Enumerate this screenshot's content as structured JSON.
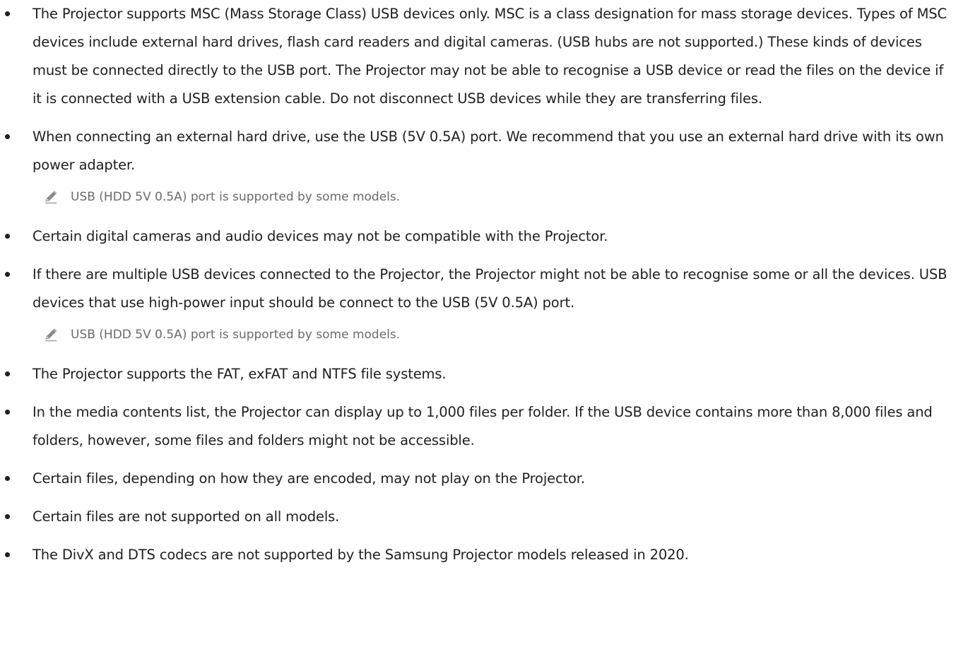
{
  "items": [
    {
      "text": "The Projector supports MSC (Mass Storage Class) USB devices only. MSC is a class designation for mass storage devices. Types of MSC devices include external hard drives, flash card readers and digital cameras. (USB hubs are not supported.) These kinds of devices must be connected directly to the USB port. The Projector may not be able to recognise a USB device or read the files on the device if it is connected with a USB extension cable. Do not disconnect USB devices while they are transferring files."
    },
    {
      "text": "When connecting an external hard drive, use the USB (5V 0.5A) port. We recommend that you use an external hard drive with its own power adapter.",
      "note": "USB (HDD 5V 0.5A) port is supported by some models."
    },
    {
      "text": "Certain digital cameras and audio devices may not be compatible with the Projector."
    },
    {
      "text": "If there are multiple USB devices connected to the Projector, the Projector might not be able to recognise some or all the devices. USB devices that use high-power input should be connect to the USB (5V 0.5A) port.",
      "note": "USB (HDD 5V 0.5A) port is supported by some models."
    },
    {
      "text": "The Projector supports the FAT, exFAT and NTFS file systems."
    },
    {
      "text": "In the media contents list, the Projector can display up to 1,000 files per folder. If the USB device contains more than 8,000 files and folders, however, some files and folders might not be accessible."
    },
    {
      "text": "Certain files, depending on how they are encoded, may not play on the Projector."
    },
    {
      "text": "Certain files are not supported on all models."
    },
    {
      "text": "The DivX and DTS codecs are not supported by the Samsung Projector models released in 2020."
    }
  ],
  "icons": {
    "note": "pencil-note-icon"
  }
}
